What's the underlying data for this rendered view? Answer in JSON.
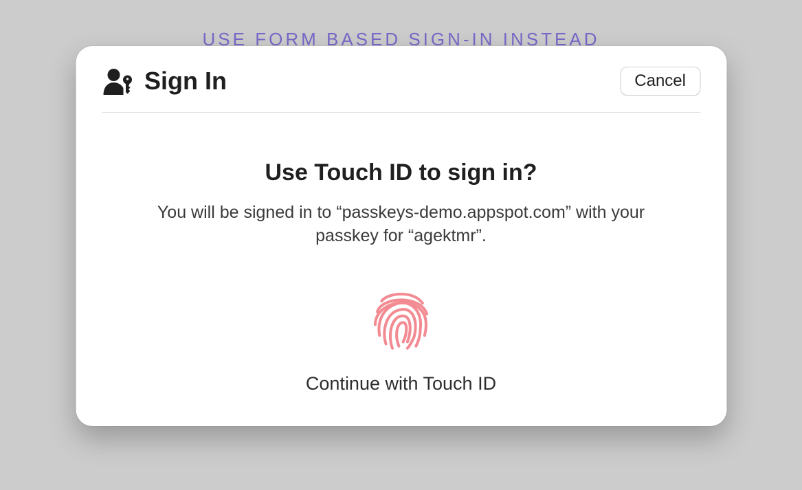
{
  "background": {
    "link_text": "USE FORM BASED SIGN-IN INSTEAD"
  },
  "dialog": {
    "title": "Sign In",
    "cancel_label": "Cancel",
    "prompt_heading": "Use Touch ID to sign in?",
    "prompt_description": "You will be signed in to “passkeys-demo.appspot.com” with your passkey for “agektmr”.",
    "continue_label": "Continue with Touch ID"
  }
}
